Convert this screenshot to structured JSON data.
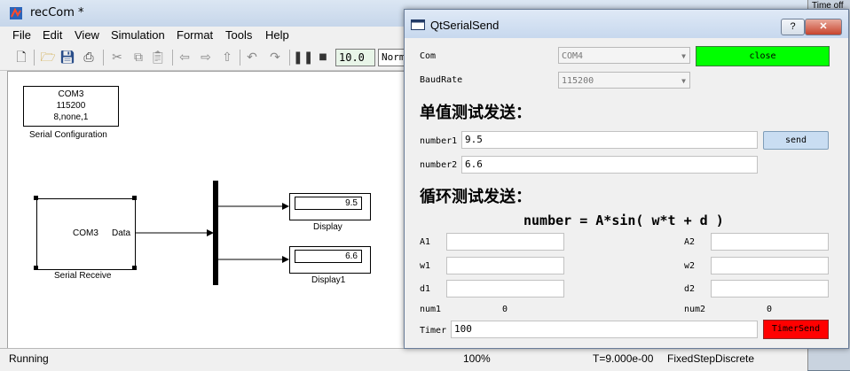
{
  "simulink": {
    "title": "recCom *",
    "menu": [
      "File",
      "Edit",
      "View",
      "Simulation",
      "Format",
      "Tools",
      "Help"
    ],
    "stop_time": "10.0",
    "sim_mode": "Normal",
    "blocks": {
      "serial_config": {
        "lines": [
          "COM3",
          "115200",
          "8,none,1"
        ],
        "name": "Serial Configuration"
      },
      "serial_receive": {
        "port": "COM3",
        "port_label": "Data",
        "name": "Serial Receive"
      },
      "display": {
        "value": "9.5",
        "name": "Display"
      },
      "display1": {
        "value": "6.6",
        "name": "Display1"
      }
    },
    "status": {
      "state": "Running",
      "zoom": "100%",
      "time": "T=9.000e-00",
      "solver": "FixedStepDiscrete"
    }
  },
  "background": {
    "time_offset_label": "Time off"
  },
  "qt": {
    "title": "QtSerialSend",
    "help_btn": "?",
    "close_btn": "✕",
    "com_label": "Com",
    "com_value": "COM4",
    "close_port_btn": "close",
    "baud_label": "BaudRate",
    "baud_value": "115200",
    "single_header": "单值测试发送：",
    "number1_label": "number1",
    "number1_value": "9.5",
    "number2_label": "number2",
    "number2_value": "6.6",
    "send_btn": "send",
    "loop_header": "循环测试发送：",
    "formula": "number = A*sin( w*t + d )",
    "A1": "A1",
    "A2": "A2",
    "w1": "w1",
    "w2": "w2",
    "d1": "d1",
    "d2": "d2",
    "num1_label": "num1",
    "num1_value": "0",
    "num2_label": "num2",
    "num2_value": "0",
    "timer_label": "Timer",
    "timer_value": "100",
    "timer_send_btn": "TimerSend"
  },
  "colors": {
    "close_btn": "#00ff00",
    "timer_btn": "#ff0000",
    "send_btn": "#c9ddf2"
  }
}
